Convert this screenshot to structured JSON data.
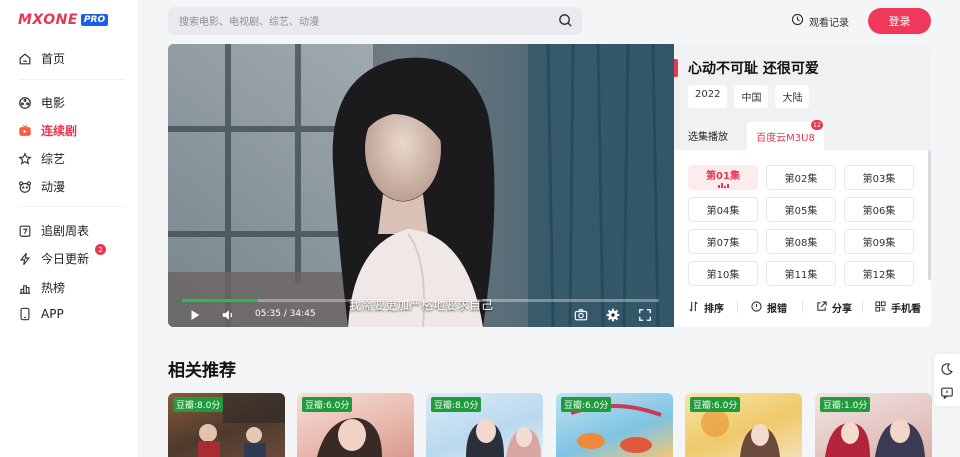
{
  "sidebar": {
    "logo_text": "MXONE",
    "logo_badge": "PRO",
    "items": [
      {
        "label": "首页",
        "icon": "home-icon"
      },
      {
        "label": "电影",
        "icon": "film-reel-icon"
      },
      {
        "label": "连续剧",
        "icon": "tv-icon",
        "active": true
      },
      {
        "label": "综艺",
        "icon": "star-icon"
      },
      {
        "label": "动漫",
        "icon": "bear-icon"
      },
      {
        "label": "追剧周表",
        "icon": "calendar-icon"
      },
      {
        "label": "今日更新",
        "icon": "lightning-icon",
        "badge": "2"
      },
      {
        "label": "热榜",
        "icon": "bar-chart-icon"
      },
      {
        "label": "APP",
        "icon": "phone-icon"
      }
    ]
  },
  "header": {
    "search_placeholder": "搜索电影、电视剧、综艺、动漫",
    "history_label": "观看记录",
    "login_label": "登录"
  },
  "player": {
    "subtitle": "我需要更加严格地要求自己",
    "current_time": "05:35",
    "duration": "34:45",
    "time_display": "05:35 / 34:45",
    "progress": 0.16
  },
  "panel": {
    "title": "心动不可耻 还很可爱",
    "tags": [
      "2022",
      "中国",
      "大陆"
    ],
    "tab_label": "选集播放",
    "source_tab": "百度云M3U8",
    "source_count": "12",
    "episodes": [
      "第01集",
      "第02集",
      "第03集",
      "第04集",
      "第05集",
      "第06集",
      "第07集",
      "第08集",
      "第09集",
      "第10集",
      "第11集",
      "第12集"
    ],
    "active_episode": 0,
    "actions": [
      {
        "label": "排序",
        "icon": "sort-icon"
      },
      {
        "label": "报错",
        "icon": "alert-icon"
      },
      {
        "label": "分享",
        "icon": "share-icon"
      },
      {
        "label": "手机看",
        "icon": "qr-code-icon"
      }
    ]
  },
  "related": {
    "title": "相关推荐",
    "cards": [
      {
        "badge": "豆瓣:8.0分"
      },
      {
        "badge": "豆瓣:6.0分"
      },
      {
        "badge": "豆瓣:8.0分"
      },
      {
        "badge": "豆瓣:6.0分"
      },
      {
        "badge": "豆瓣:6.0分"
      },
      {
        "badge": "豆瓣:1.0分"
      }
    ]
  },
  "float_tools": [
    "moon-icon",
    "feedback-icon"
  ],
  "colors": {
    "accent": "#e8384f",
    "progress": "#1fc24f",
    "rating_badge": "#1e9b3a"
  }
}
